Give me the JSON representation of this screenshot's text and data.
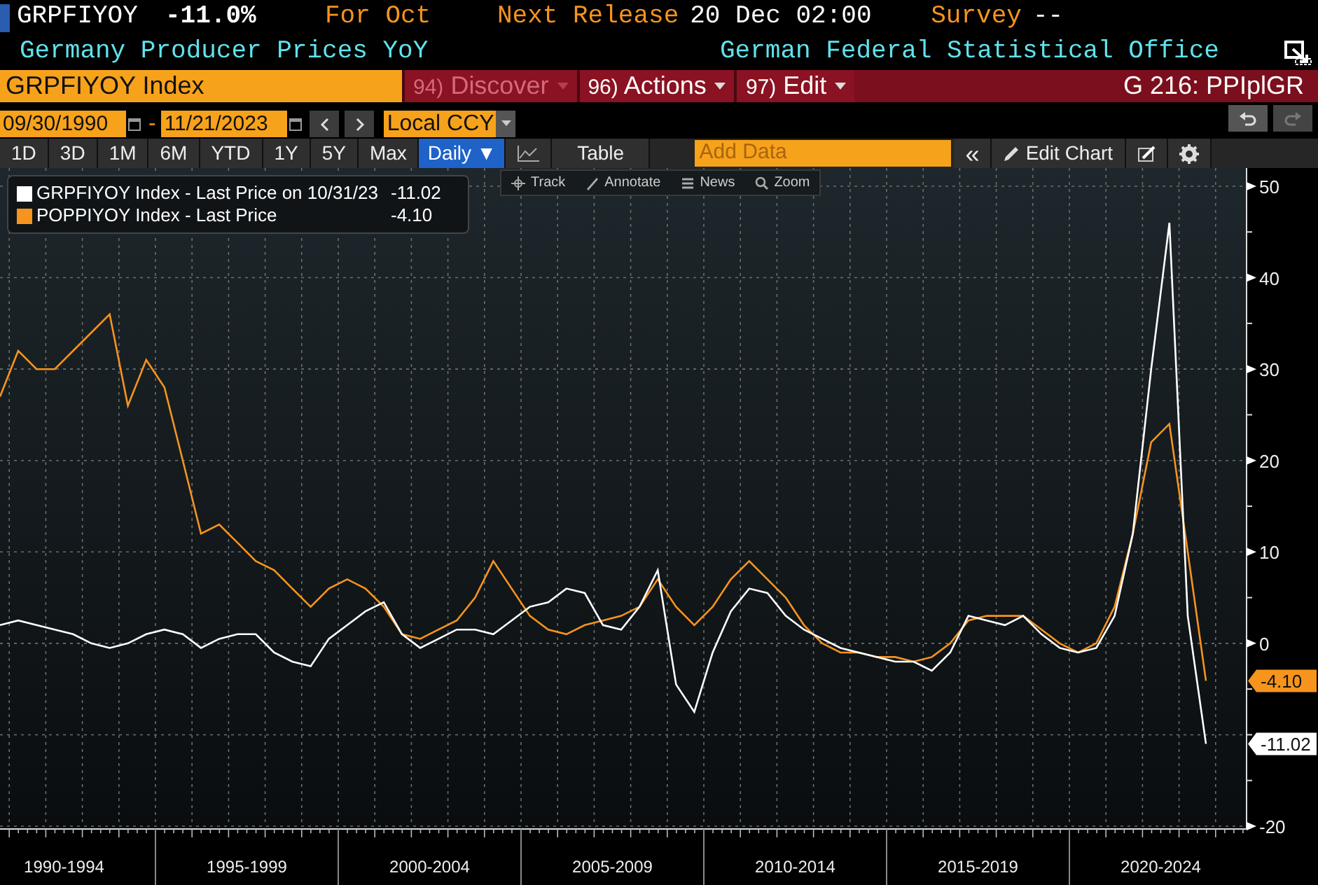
{
  "header": {
    "ticker": "GRPFIYOY",
    "change": "-11.0%",
    "period": "For Oct",
    "release_label": "Next Release",
    "release_value": "20 Dec 02:00",
    "survey_label": "Survey",
    "survey_value": "--",
    "title": "Germany Producer Prices YoY",
    "source": "German Federal Statistical Office"
  },
  "command_bar": {
    "security": "GRPFIYOY Index",
    "menus": [
      {
        "number": "94)",
        "label": "Discover",
        "disabled": true
      },
      {
        "number": "96)",
        "label": "Actions",
        "disabled": false
      },
      {
        "number": "97)",
        "label": "Edit",
        "disabled": false
      }
    ],
    "page_code": "G 216: PPIplGR"
  },
  "date_range": {
    "start": "09/30/1990",
    "separator": "-",
    "end": "11/21/2023",
    "currency": "Local CCY"
  },
  "toolbar": {
    "ranges": [
      {
        "label": "1D",
        "selected": false
      },
      {
        "label": "3D",
        "selected": false
      },
      {
        "label": "1M",
        "selected": false
      },
      {
        "label": "6M",
        "selected": false
      },
      {
        "label": "YTD",
        "selected": false
      },
      {
        "label": "1Y",
        "selected": false
      },
      {
        "label": "5Y",
        "selected": false
      },
      {
        "label": "Max",
        "selected": false
      }
    ],
    "frequency": "Daily ▼",
    "table": "Table",
    "add_data_placeholder": "Add Data",
    "collapse": "«",
    "edit_chart": "Edit Chart"
  },
  "chart_tools": [
    "Track",
    "Annotate",
    "News",
    "Zoom"
  ],
  "legend": [
    {
      "suffix": " - Last Price on 10/31/23",
      "value": "-11.02"
    },
    {
      "suffix": " - Last Price",
      "value": "-4.10"
    }
  ],
  "chart": {
    "chart_data": {
      "type": "line",
      "categories": [
        null,
        null,
        null,
        null,
        null,
        null,
        null,
        null,
        null,
        null,
        null,
        null,
        null,
        null,
        null,
        null,
        null,
        null,
        null,
        null,
        null,
        null,
        null,
        null,
        null,
        null,
        null,
        null,
        null,
        null,
        null,
        null,
        null,
        null,
        null,
        null,
        null,
        null,
        null,
        null,
        null,
        null,
        null,
        null,
        null,
        null,
        null,
        null,
        null,
        null,
        null,
        null,
        null,
        null,
        null,
        null,
        null,
        null,
        null,
        null,
        null,
        null,
        null,
        null,
        null,
        null,
        null
      ],
      "series": [
        {
          "name": "GRPFIYOY Index",
          "color": "#ffffff",
          "values": [
            2,
            2.5,
            2,
            1.5,
            1,
            0,
            -0.5,
            0,
            1,
            1.5,
            1,
            -0.5,
            0.5,
            1,
            1,
            -1,
            -2,
            -2.5,
            0.5,
            2,
            3.5,
            4.5,
            1,
            -0.5,
            0.5,
            1.5,
            1.5,
            1,
            2.5,
            4,
            4.5,
            6,
            5.5,
            2,
            1.5,
            4,
            8,
            -4.5,
            -7.5,
            -1,
            3.5,
            6,
            5.5,
            3,
            1.5,
            0.5,
            -0.5,
            -1,
            -1.5,
            -2,
            -2,
            -3,
            -1,
            3,
            2.5,
            2,
            3,
            1,
            -0.5,
            -1,
            -0.5,
            3,
            12,
            30,
            46,
            3,
            -11
          ]
        },
        {
          "name": "POPPIYOY Index",
          "color": "#f7941d",
          "values": [
            27,
            32,
            30,
            30,
            32,
            34,
            36,
            26,
            31,
            28,
            20,
            12,
            13,
            11,
            9,
            8,
            6,
            4,
            6,
            7,
            6,
            4,
            1,
            0.5,
            1.5,
            2.5,
            5,
            9,
            6,
            3,
            1.5,
            1,
            2,
            2.5,
            3,
            4,
            7,
            4,
            2,
            4,
            7,
            9,
            7,
            5,
            2,
            0,
            -1,
            -1,
            -1.5,
            -1.5,
            -2,
            -1.5,
            0,
            2.5,
            3,
            3,
            3,
            1.5,
            0,
            -1,
            0,
            4,
            12,
            22,
            24,
            10,
            -4.1
          ]
        }
      ],
      "ylim": [
        -20,
        50
      ],
      "grid": true,
      "yticks": [
        -20,
        0,
        10,
        20,
        30,
        40,
        50
      ]
    },
    "period_labels": [
      "1990-1994",
      "1995-1999",
      "2000-2004",
      "2005-2009",
      "2010-2014",
      "2015-2019",
      "2020-2024"
    ],
    "last_value_tags": [
      {
        "text": "-4.10",
        "color": "#f7941d"
      },
      {
        "text": "-11.02",
        "color": "#ffffff"
      }
    ]
  }
}
